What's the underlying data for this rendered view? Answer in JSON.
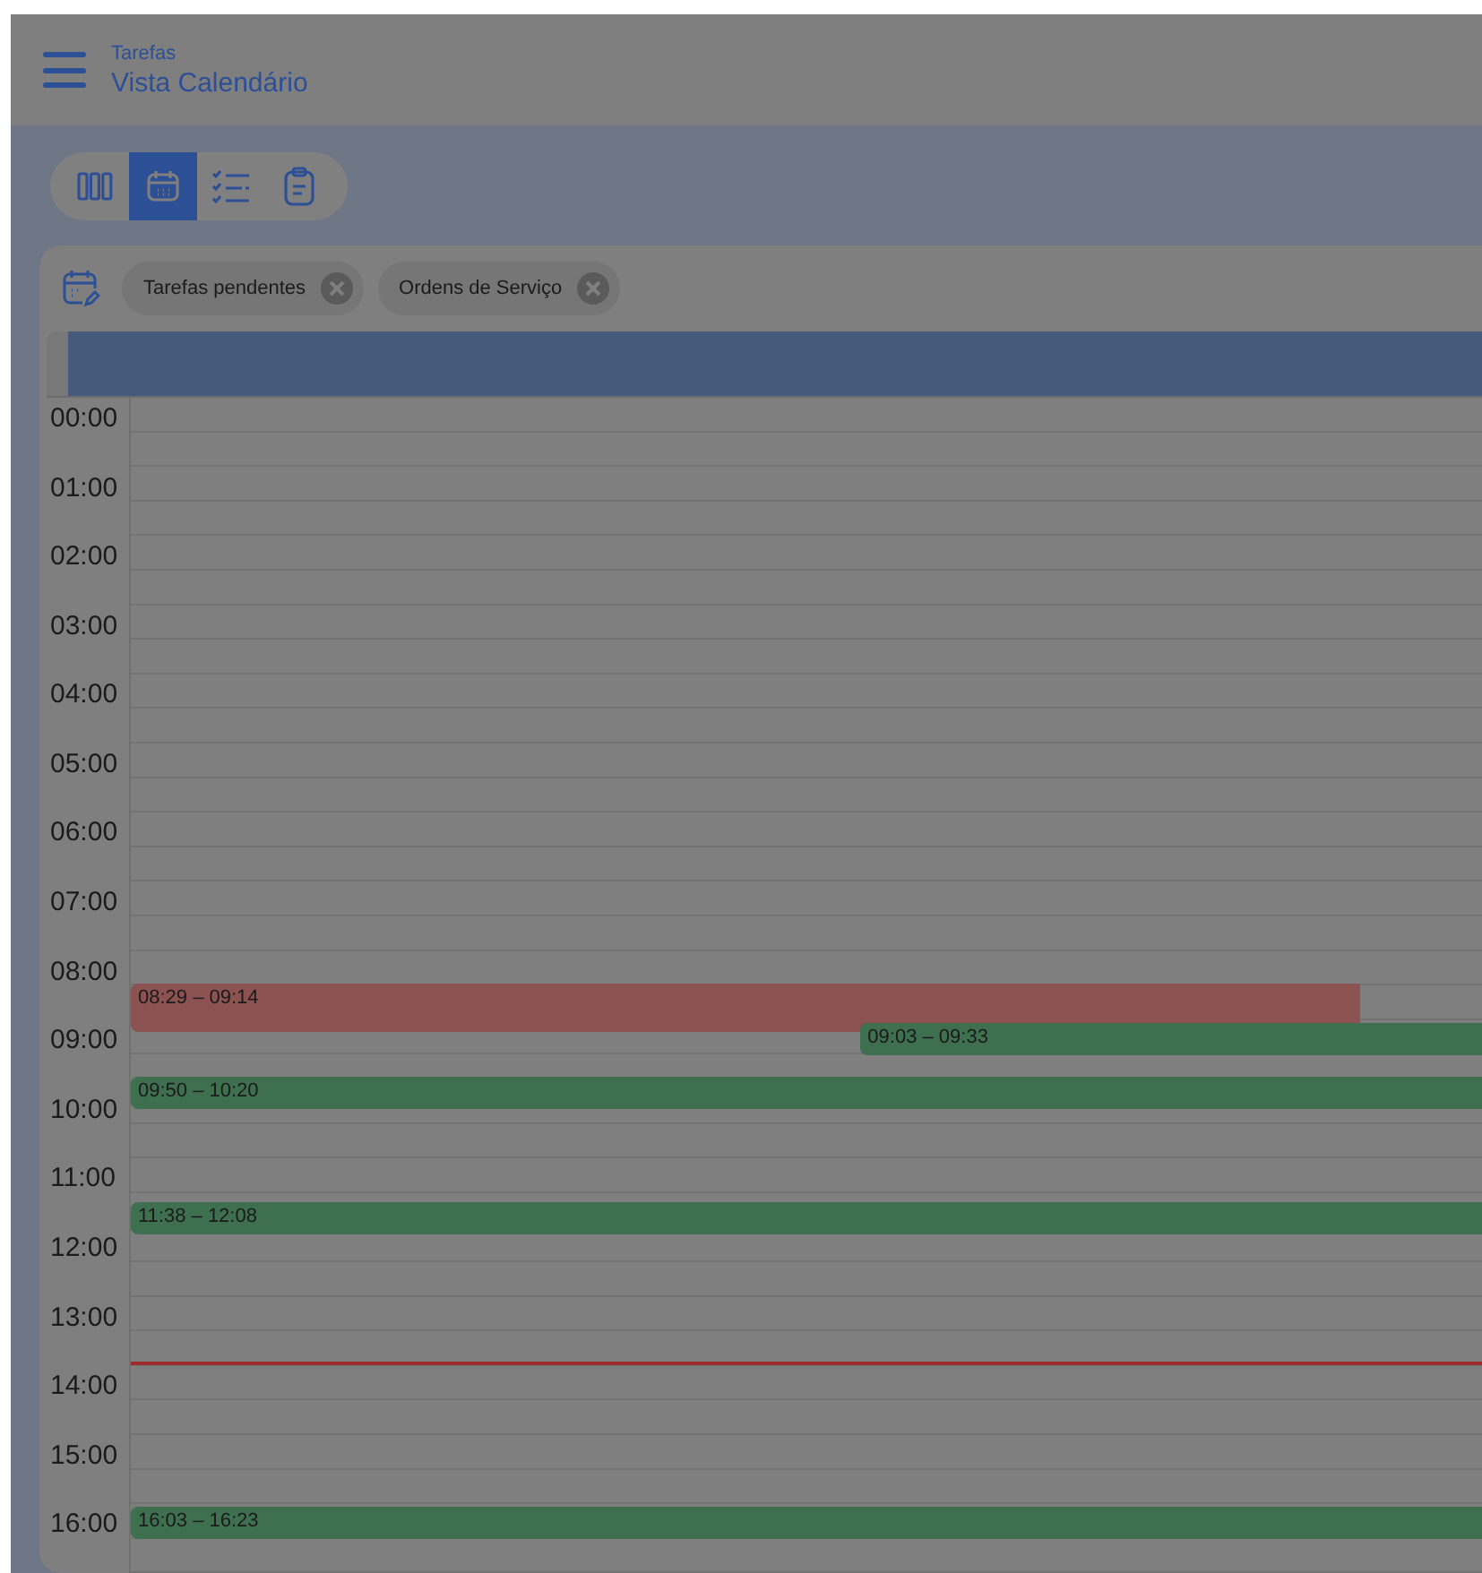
{
  "header": {
    "section": "Tarefas",
    "title": "Vista Calendário"
  },
  "views": [
    {
      "kind": "columns",
      "selected": false
    },
    {
      "kind": "calendar",
      "selected": true
    },
    {
      "kind": "checklist",
      "selected": false
    },
    {
      "kind": "clipboard",
      "selected": false
    }
  ],
  "filters": [
    {
      "label": "Tarefas pendentes"
    },
    {
      "label": "Ordens de Serviço"
    }
  ],
  "hours": [
    "00:00",
    "01:00",
    "02:00",
    "03:00",
    "04:00",
    "05:00",
    "06:00",
    "07:00",
    "08:00",
    "09:00",
    "10:00",
    "11:00",
    "12:00",
    "13:00",
    "14:00",
    "15:00",
    "16:00"
  ],
  "events": [
    {
      "time": "08:29 – 09:14",
      "color": "#8c5252"
    },
    {
      "time": "09:03 – 09:33",
      "color": "#3e7050"
    },
    {
      "time": "09:50 – 10:20",
      "color": "#3e7050"
    },
    {
      "time": "11:38 – 12:08",
      "color": "#3e7050"
    },
    {
      "time": "16:03 – 16:23",
      "color": "#3e7050"
    }
  ]
}
